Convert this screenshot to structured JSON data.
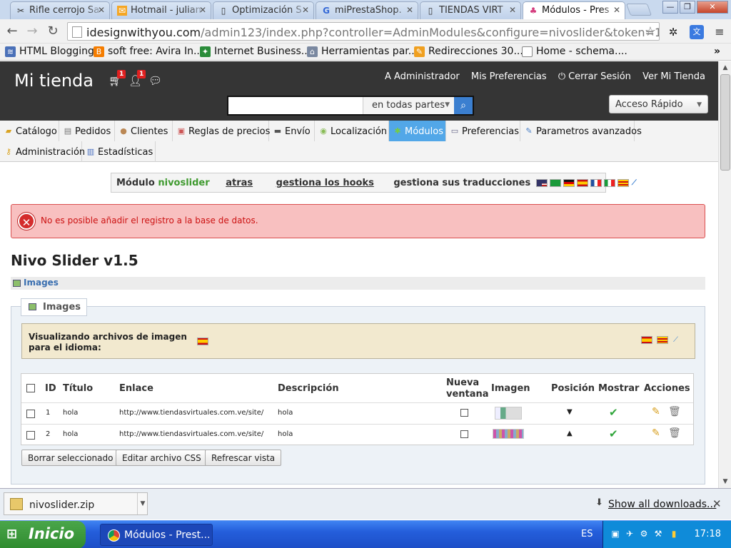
{
  "browser": {
    "tabs": [
      {
        "title": "Rifle cerrojo Sa",
        "icon": "scissors-icon"
      },
      {
        "title": "Hotmail - julian",
        "icon": "hotmail-icon"
      },
      {
        "title": "Optimización S",
        "icon": "page-icon"
      },
      {
        "title": "miPrestaShop.",
        "icon": "google-icon"
      },
      {
        "title": "TIENDAS VIRT",
        "icon": "page-icon"
      },
      {
        "title": "Módulos - Pres",
        "icon": "prestashop-icon"
      }
    ],
    "url_host": "idesignwithyou.com",
    "url_path": "/admin123/index.php?controller=AdminModules&configure=nivoslider&token=188064",
    "bookmarks": [
      "HTML Blogging",
      "soft free: Avira In...",
      "Internet Business...",
      "Herramientas par...",
      "Redirecciones 30...",
      "Home - schema...."
    ]
  },
  "header": {
    "shop_name": "Mi tienda",
    "cart_badge": "1",
    "customers_badge": "1",
    "links": [
      "A Administrador",
      "Mis Preferencias",
      "Cerrar Sesión",
      "Ver Mi Tienda"
    ],
    "search_value": "",
    "search_scope": "en todas partes",
    "quick_access": "Acceso Rápido"
  },
  "menu": [
    "Catálogo",
    "Pedidos",
    "Clientes",
    "Reglas de precios",
    "Envío",
    "Localización",
    "Módulos",
    "Preferencias",
    "Parametros avanzados",
    "Administración",
    "Estadísticas"
  ],
  "module_bar": {
    "prefix": "Módulo",
    "name": "nivoslider",
    "back": "atras",
    "hooks": "gestiona los hooks",
    "translations": "gestiona sus traducciones"
  },
  "error": "No es posible añadir el registro a la base de datos.",
  "page_title": "Nivo Slider v1.5",
  "section_label": "Images",
  "fieldset_legend": "Images",
  "info_text": "Visualizando archivos de imagen para el idioma:",
  "table": {
    "headers": {
      "id": "ID",
      "title": "Título",
      "link": "Enlace",
      "description": "Descripción",
      "new_window_1": "Nueva",
      "new_window_2": "ventana",
      "image": "Imagen",
      "position": "Posición",
      "show": "Mostrar",
      "actions": "Acciones"
    },
    "rows": [
      {
        "id": "1",
        "title": "hola",
        "link": "http://www.tiendasvirtuales.com.ve/site/",
        "description": "hola",
        "position_arrow": "▼"
      },
      {
        "id": "2",
        "title": "hola",
        "link": "http://www.tiendasvirtuales.com.ve/site/",
        "description": "hola",
        "position_arrow": "▲"
      }
    ]
  },
  "buttons": {
    "delete_selected": "Borrar seleccionado",
    "edit_css": "Editar archivo CSS",
    "refresh": "Refrescar vista"
  },
  "downloads": {
    "file": "nivoslider.zip",
    "show_all": "Show all downloads..."
  },
  "taskbar": {
    "start": "Inicio",
    "window": "Módulos - Prest...",
    "lang": "ES",
    "clock": "17:18"
  },
  "colors": {
    "accent_active_menu": "#52a7e8",
    "header_bg": "#353535",
    "error_bg": "#f8c0c0",
    "module_name": "#3f9a2f"
  }
}
